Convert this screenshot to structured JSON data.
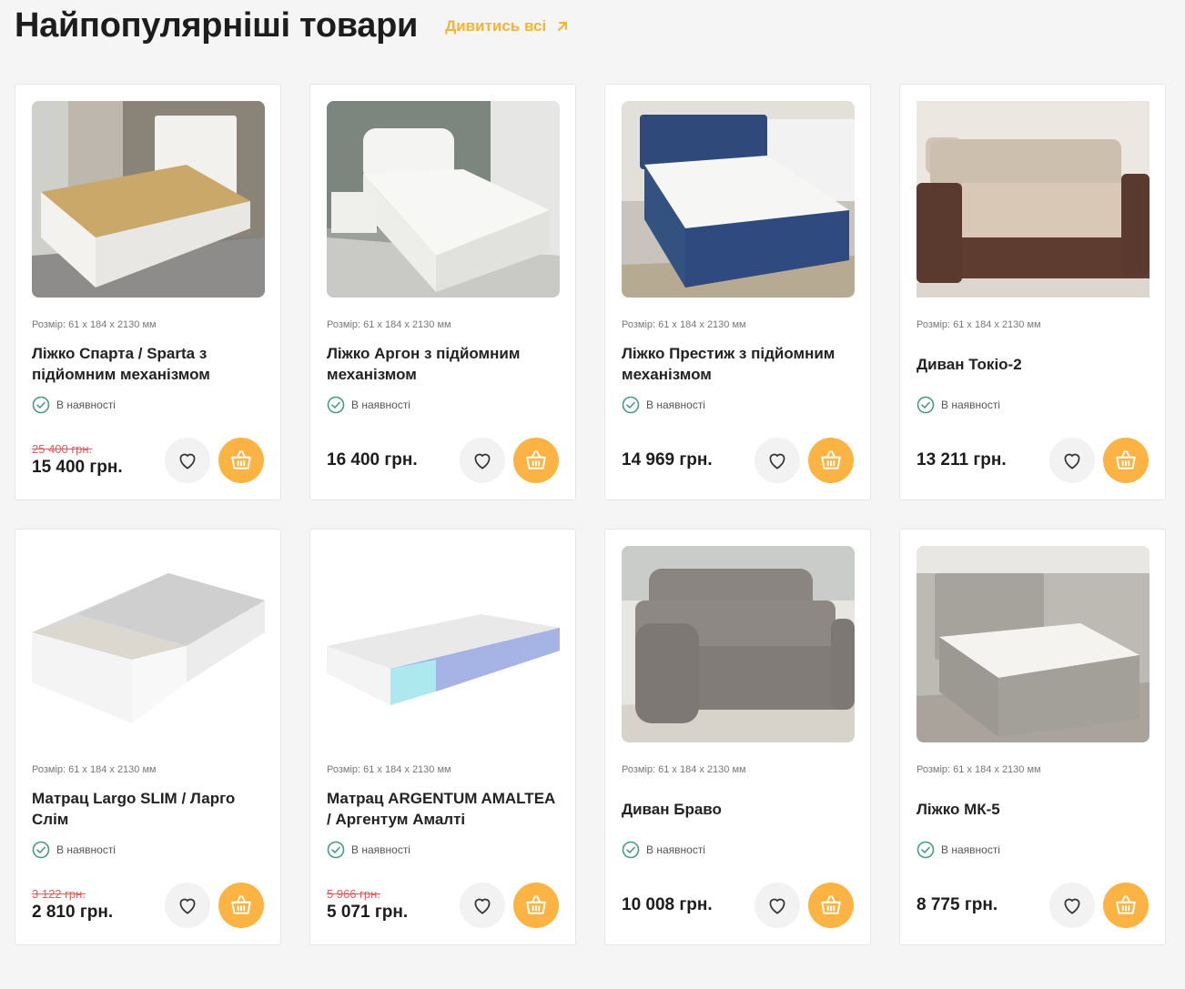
{
  "section": {
    "title": "Найпопулярніші товари",
    "view_all": "Дивитись всі"
  },
  "colors": {
    "accent": "#fbb443",
    "old_price": "#e25a5a",
    "stock_check": "#4a9a7e"
  },
  "products": [
    {
      "size": "Розмір: 61 х 184 х 2130 мм",
      "name": "Ліжко Спарта / Sparta з підйомним механізмом",
      "stock": "В наявності",
      "old_price": "25 400 грн.",
      "price": "15 400 грн.",
      "image": "white-bed-slatted-base-photo"
    },
    {
      "size": "Розмір: 61 х 184 х 2130 мм",
      "name": "Ліжко Аргон з підйомним механізмом",
      "stock": "В наявності",
      "old_price": "",
      "price": "16 400 грн.",
      "image": "white-bed-nightstand-photo"
    },
    {
      "size": "Розмір: 61 х 184 х 2130 мм",
      "name": "Ліжко Престиж з підйомним механізмом",
      "stock": "В наявності",
      "old_price": "",
      "price": "14 969 грн.",
      "image": "blue-upholstered-bed-photo"
    },
    {
      "size": "Розмір: 61 х 184 х 2130 мм",
      "name": "Диван Токіо-2",
      "stock": "В наявності",
      "old_price": "",
      "price": "13 211 грн.",
      "image": "brown-sofa-pillows-photo"
    },
    {
      "size": "Розмір: 61 х 184 х 2130 мм",
      "name": "Матрац Largo SLIM / Ларго Слім",
      "stock": "В наявності",
      "old_price": "3 122 грн.",
      "price": "2 810 грн.",
      "image": "white-mattress-render"
    },
    {
      "size": "Розмір: 61 х 184 х 2130 мм",
      "name": "Матрац ARGENTUM AMALTEA / Аргентум Амалті",
      "stock": "В наявності",
      "old_price": "5 966 грн.",
      "price": "5 071 грн.",
      "image": "layered-mattress-render"
    },
    {
      "size": "Розмір: 61 х 184 х 2130 мм",
      "name": "Диван Браво",
      "stock": "В наявності",
      "old_price": "",
      "price": "10 008 грн.",
      "image": "grey-sofa-showroom-photo"
    },
    {
      "size": "Розмір: 61 х 184 х 2130 мм",
      "name": "Ліжко МК-5",
      "stock": "В наявності",
      "old_price": "",
      "price": "8 775 грн.",
      "image": "grey-bed-mattress-photo"
    }
  ]
}
